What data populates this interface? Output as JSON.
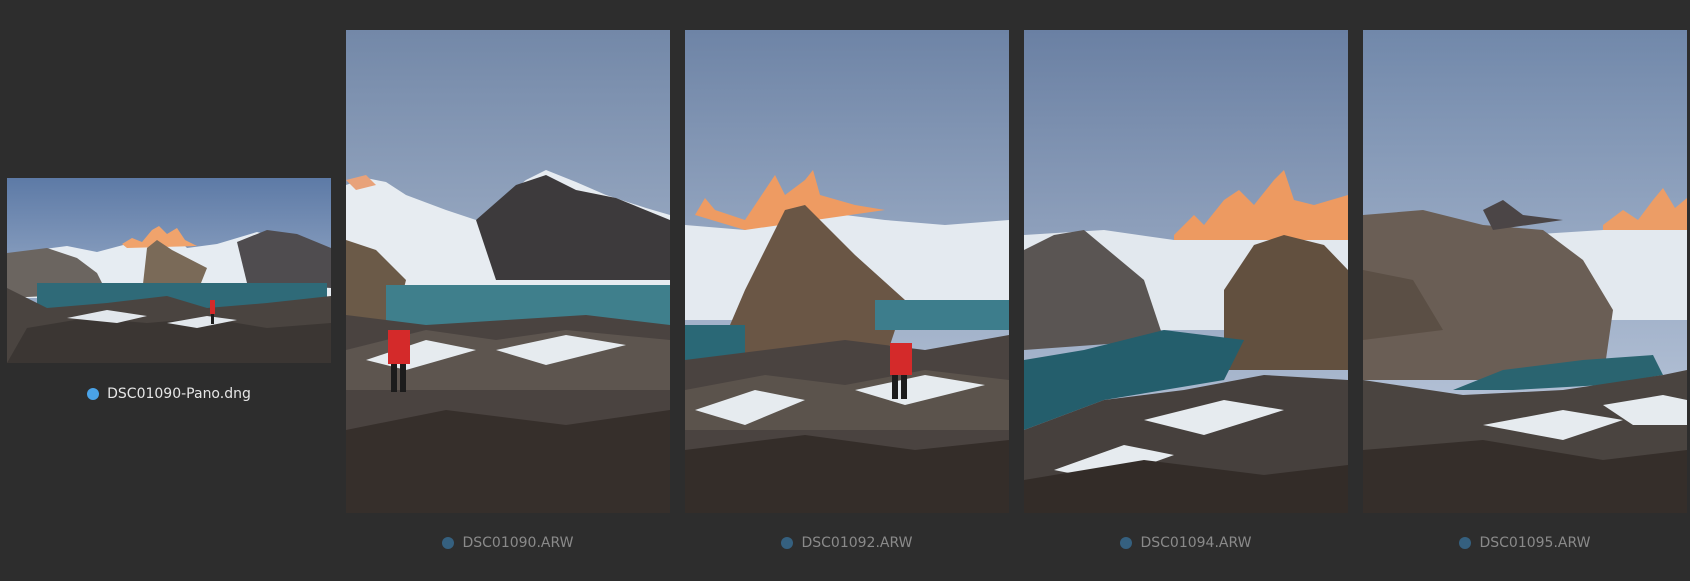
{
  "filmstrip": {
    "items": [
      {
        "filename": "DSC01090-Pano.dng",
        "label_color": "#4aa3e8",
        "selected": true,
        "type": "panorama"
      },
      {
        "filename": "DSC01090.ARW",
        "label_color": "#35607f",
        "selected": false,
        "type": "portrait"
      },
      {
        "filename": "DSC01092.ARW",
        "label_color": "#35607f",
        "selected": false,
        "type": "portrait"
      },
      {
        "filename": "DSC01094.ARW",
        "label_color": "#35607f",
        "selected": false,
        "type": "portrait"
      },
      {
        "filename": "DSC01095.ARW",
        "label_color": "#35607f",
        "selected": false,
        "type": "portrait"
      }
    ]
  },
  "colors": {
    "background": "#2d2d2d",
    "caption_active": "#e6e6e6",
    "caption_inactive": "#8a8a8a"
  }
}
